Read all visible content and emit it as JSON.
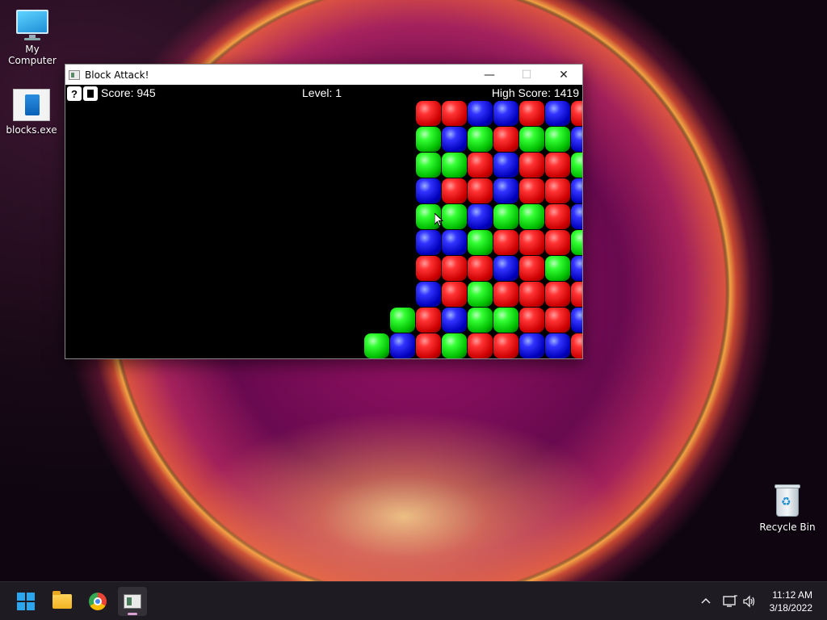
{
  "desktop": {
    "icons": [
      {
        "label": "My Computer"
      },
      {
        "label": "blocks.exe"
      },
      {
        "label": "Recycle Bin"
      }
    ]
  },
  "window": {
    "title": "Block Attack!",
    "controls": {
      "minimize": "—",
      "maximize": "☐",
      "close": "✕"
    }
  },
  "game": {
    "help_label": "?",
    "score_text": "Score: 945",
    "level_text": "Level: 1",
    "high_score_text": "High Score: 1419",
    "board_colors": {
      "red": "#e02020",
      "green": "#20c020",
      "blue": "#2020d0"
    },
    "board": [
      [
        "",
        "",
        "",
        "",
        "",
        "",
        "",
        "",
        "",
        "",
        "",
        "",
        "",
        "red",
        "red",
        "blue",
        "blue",
        "red",
        "blue",
        "red"
      ],
      [
        "",
        "",
        "",
        "",
        "",
        "",
        "",
        "",
        "",
        "",
        "",
        "",
        "",
        "green",
        "blue",
        "green",
        "red",
        "green",
        "green",
        "blue"
      ],
      [
        "",
        "",
        "",
        "",
        "",
        "",
        "",
        "",
        "",
        "",
        "",
        "",
        "",
        "green",
        "green",
        "red",
        "blue",
        "red",
        "red",
        "green"
      ],
      [
        "",
        "",
        "",
        "",
        "",
        "",
        "",
        "",
        "",
        "",
        "",
        "",
        "",
        "blue",
        "red",
        "red",
        "blue",
        "red",
        "red",
        "blue"
      ],
      [
        "",
        "",
        "",
        "",
        "",
        "",
        "",
        "",
        "",
        "",
        "",
        "",
        "",
        "green",
        "green",
        "blue",
        "green",
        "green",
        "red",
        "blue"
      ],
      [
        "",
        "",
        "",
        "",
        "",
        "",
        "",
        "",
        "",
        "",
        "",
        "",
        "",
        "blue",
        "blue",
        "green",
        "red",
        "red",
        "red",
        "green"
      ],
      [
        "",
        "",
        "",
        "",
        "",
        "",
        "",
        "",
        "",
        "",
        "",
        "",
        "",
        "red",
        "red",
        "red",
        "blue",
        "red",
        "green",
        "blue"
      ],
      [
        "",
        "",
        "",
        "",
        "",
        "",
        "",
        "",
        "",
        "",
        "",
        "",
        "",
        "blue",
        "red",
        "green",
        "red",
        "red",
        "red",
        "red"
      ],
      [
        "",
        "",
        "",
        "",
        "",
        "",
        "",
        "",
        "",
        "",
        "",
        "",
        "green",
        "red",
        "blue",
        "green",
        "green",
        "red",
        "red",
        "blue"
      ],
      [
        "",
        "",
        "",
        "",
        "",
        "",
        "",
        "",
        "",
        "",
        "",
        "green",
        "blue",
        "red",
        "green",
        "red",
        "red",
        "blue",
        "blue",
        "red"
      ]
    ]
  },
  "taskbar": {
    "pinned": [
      {
        "name": "start-icon"
      },
      {
        "name": "file-explorer-icon"
      },
      {
        "name": "chrome-icon"
      },
      {
        "name": "block-attack-icon"
      }
    ],
    "tray": {
      "chevron": "^",
      "network": "network-icon",
      "volume": "volume-icon"
    },
    "clock": {
      "time": "11:12 AM",
      "date": "3/18/2022"
    }
  }
}
